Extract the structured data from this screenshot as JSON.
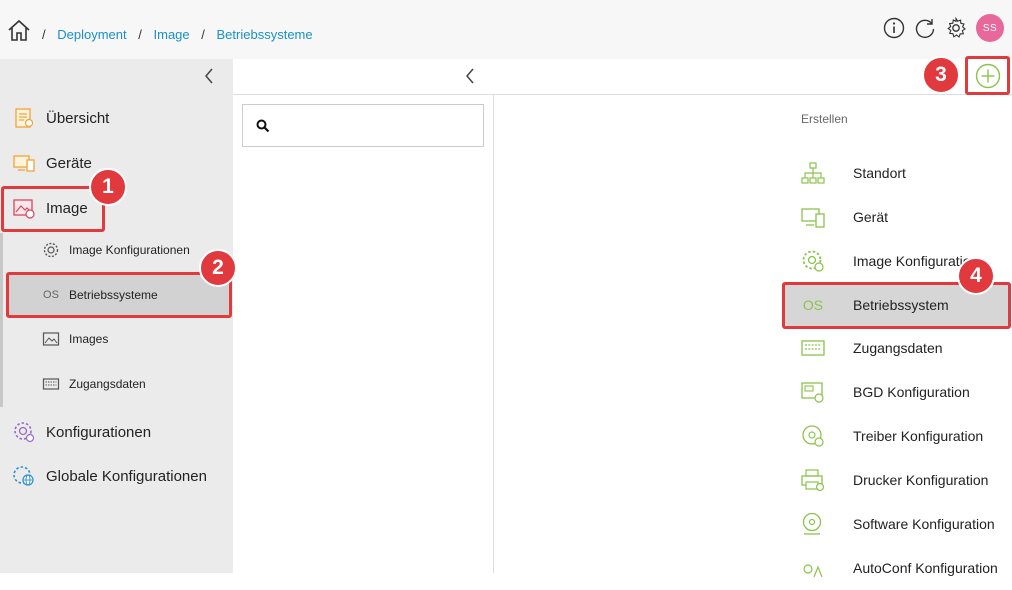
{
  "breadcrumb": {
    "separator": "/",
    "items": [
      "Deployment",
      "Image",
      "Betriebssysteme"
    ]
  },
  "user": {
    "initials": "SS",
    "avatar_color": "#e8689c"
  },
  "sidebar": {
    "items": [
      {
        "label": "Übersicht",
        "icon": "overview-icon"
      },
      {
        "label": "Geräte",
        "icon": "devices-icon"
      },
      {
        "label": "Image",
        "icon": "image-icon"
      },
      {
        "label": "Konfigurationen",
        "icon": "configurations-icon"
      },
      {
        "label": "Globale Konfigurationen",
        "icon": "global-configurations-icon"
      }
    ],
    "subitems": [
      {
        "label": "Image Konfigurationen",
        "icon": "gear-icon"
      },
      {
        "label": "Betriebssysteme",
        "icon": "os-icon",
        "icon_text": "OS"
      },
      {
        "label": "Images",
        "icon": "image-icon"
      },
      {
        "label": "Zugangsdaten",
        "icon": "credentials-icon"
      }
    ]
  },
  "create_menu": {
    "title": "Erstellen",
    "items": [
      {
        "label": "Standort",
        "icon": "sitemap-icon"
      },
      {
        "label": "Gerät",
        "icon": "device-icon"
      },
      {
        "label": "Image Konfiguration",
        "icon": "gear-icon"
      },
      {
        "label": "Betriebssystem",
        "icon": "os-icon",
        "icon_text": "OS"
      },
      {
        "label": "Zugangsdaten",
        "icon": "credentials-icon"
      },
      {
        "label": "BGD Konfiguration",
        "icon": "bgd-icon"
      },
      {
        "label": "Treiber Konfiguration",
        "icon": "driver-icon"
      },
      {
        "label": "Drucker Konfiguration",
        "icon": "printer-icon"
      },
      {
        "label": "Software Konfiguration",
        "icon": "software-icon"
      },
      {
        "label": "AutoConf Konfiguration",
        "icon": "autoconf-icon"
      }
    ]
  },
  "callouts": [
    "1",
    "2",
    "3",
    "4"
  ],
  "colors": {
    "accent_green": "#8bc34a",
    "callout_red": "#e0393e",
    "link_blue": "#1a8fc9"
  }
}
